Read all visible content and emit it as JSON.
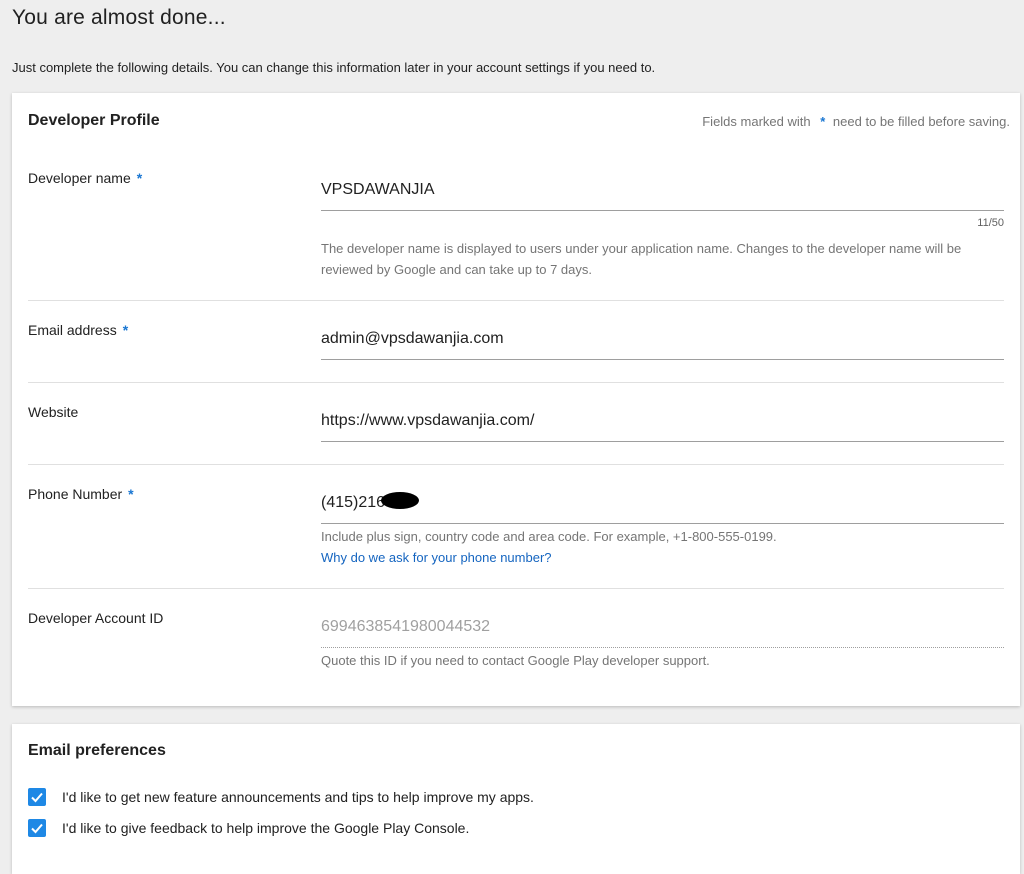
{
  "page": {
    "title": "You are almost done...",
    "subtitle": "Just complete the following details. You can change this information later in your account settings if you need to."
  },
  "profile": {
    "title": "Developer Profile",
    "required_note_prefix": "Fields marked with",
    "required_star": "*",
    "required_note_suffix": "need to be filled before saving.",
    "developer_name": {
      "label": "Developer name",
      "star": "*",
      "value": "VPSDAWANJIA",
      "counter": "11/50",
      "helper": "The developer name is displayed to users under your application name. Changes to the developer name will be reviewed by Google and can take up to 7 days."
    },
    "email": {
      "label": "Email address",
      "star": "*",
      "value": "admin@vpsdawanjia.com"
    },
    "website": {
      "label": "Website",
      "value": "https://www.vpsdawanjia.com/"
    },
    "phone": {
      "label": "Phone Number",
      "star": "*",
      "value": "(415)216",
      "helper": "Include plus sign, country code and area code. For example, +1-800-555-0199.",
      "link": "Why do we ask for your phone number?"
    },
    "account_id": {
      "label": "Developer Account ID",
      "value": "6994638541980044532",
      "helper": "Quote this ID if you need to contact Google Play developer support."
    }
  },
  "prefs": {
    "title": "Email preferences",
    "options": [
      {
        "label": "I'd like to get new feature announcements and tips to help improve my apps.",
        "checked": true
      },
      {
        "label": "I'd like to give feedback to help improve the Google Play Console.",
        "checked": true
      }
    ]
  },
  "colors": {
    "accent": "#1e88e5",
    "link": "#1565c0",
    "background": "#eeeeee"
  }
}
